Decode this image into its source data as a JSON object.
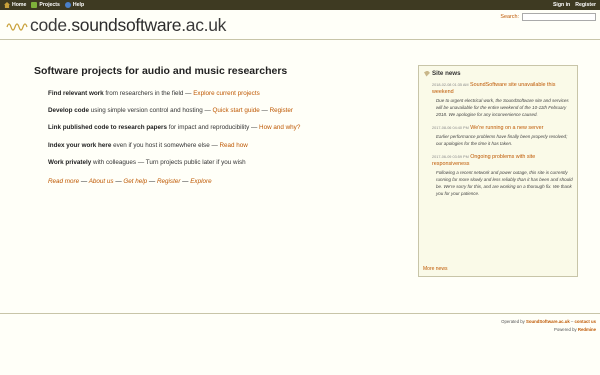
{
  "top_menu": {
    "home": "Home",
    "projects": "Projects",
    "help": "Help",
    "sign_in": "Sign in",
    "register": "Register"
  },
  "header": {
    "logo_light": "code.",
    "logo_bold": "soundsoftware",
    "logo_tail": ".ac.uk",
    "search_label": "Search:",
    "search_value": ""
  },
  "intro": {
    "title": "Software projects for audio and music researchers",
    "features": [
      {
        "bold": "Find relevant work",
        "text": " from researchers in the field — ",
        "link": "Explore current projects"
      },
      {
        "bold": "Develop code",
        "text": " using simple version control and hosting — ",
        "link": "Quick start guide",
        "sep": " — ",
        "link2": "Register"
      },
      {
        "bold": "Link published code to research papers",
        "text": " for impact and reproducibility — ",
        "link": "How and why?"
      },
      {
        "bold": "Index your work here",
        "text": " even if you host it somewhere else — ",
        "link": "Read how"
      },
      {
        "bold": "Work privately",
        "text": " with colleagues — Turn projects public later if you wish"
      }
    ],
    "links": [
      "Read more",
      "About us",
      "Get help",
      "Register",
      "Explore"
    ],
    "link_sep": " — "
  },
  "news": {
    "title": "Site news",
    "items": [
      {
        "date": "2018-02-08 01:35 AM",
        "title": "SoundSoftware site unavailable this weekend",
        "body": "Due to urgent electrical work, the SoundSoftware site and services will be unavailable for the entire weekend of the 10-11th February 2018. We apologise for any inconvenience caused."
      },
      {
        "date": "2017-08-06 04:40 PM",
        "title": "We're running on a new server",
        "body": "Earlier performance problems have finally been properly resolved; our apologies for the time it has taken."
      },
      {
        "date": "2017-06-09 03:59 PM",
        "title": "Ongoing problems with site responsiveness",
        "body": "Following a recent network and power outage, this site is currently running far more slowly and less reliably than it has been and should be. We're sorry for this, and are working on a thorough fix. We thank you for your patience."
      }
    ],
    "more": "More news"
  },
  "footer": {
    "operated_prefix": "Operated by ",
    "operated_link": "SoundSoftware.ac.uk",
    "contact_sep": " – ",
    "contact_link": "contact us",
    "powered_prefix": "Powered by ",
    "powered_link": "Redmine"
  },
  "colors": {
    "accent": "#be5700",
    "menu_bg": "#3e3a22",
    "page_bg": "#fffff8",
    "news_bg": "#fafae8"
  }
}
